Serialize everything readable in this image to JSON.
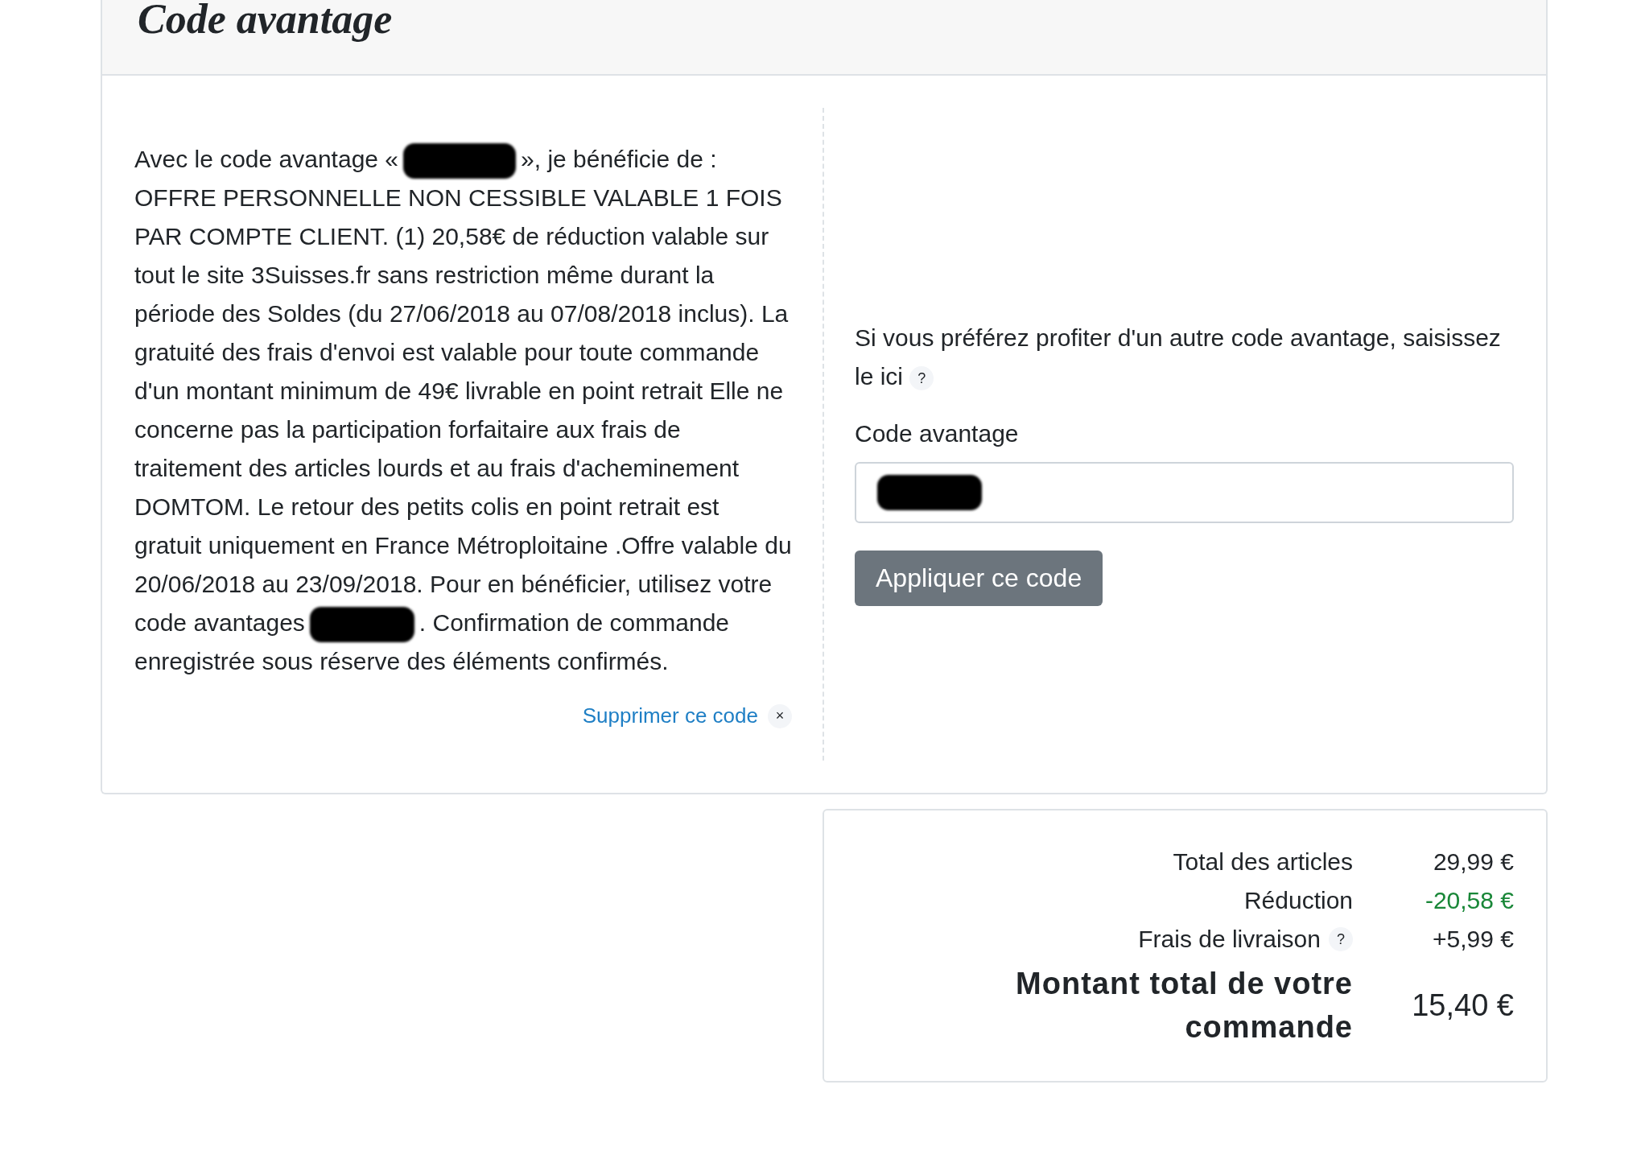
{
  "header": {
    "title": "Code avantage"
  },
  "applied_code": {
    "description_parts": [
      "Avec le code avantage «",
      "», je bénéficie de : OFFRE PERSONNELLE NON CESSIBLE VALABLE 1 FOIS PAR COMPTE CLIENT. (1) 20,58€ de réduction valable sur tout le site 3Suisses.fr sans restriction même durant la période des Soldes (du 27/06/2018 au 07/08/2018 inclus). La gratuité des frais d'envoi est valable pour toute commande d'un montant minimum de 49€ livrable en point retrait Elle ne concerne pas la participation forfaitaire aux frais de traitement des articles lourds et au frais d'acheminement DOMTOM. Le retour des petits colis en point retrait est gratuit uniquement en France Métroploitaine .Offre valable du 20/06/2018 au 23/09/2018. Pour en bénéficier, utilisez votre code avantages",
      ". Confirmation de commande enregistrée sous réserve des éléments confirmés."
    ],
    "remove_link": "Supprimer ce code",
    "remove_icon": "×"
  },
  "other_code": {
    "prompt": "Si vous préférez profiter d'un autre code avantage, saisissez le ici",
    "help": "?",
    "field_label": "Code avantage",
    "field_redacted": true,
    "button": "Appliquer ce code"
  },
  "summary": {
    "rows": [
      {
        "label": "Total des articles",
        "value": "29,99 €",
        "kind": "plain"
      },
      {
        "label": "Réduction",
        "value": "-20,58 €",
        "kind": "discount"
      },
      {
        "label": "Frais de livraison",
        "help": "?",
        "value": "+5,99 €",
        "kind": "plain"
      },
      {
        "label": "Montant total de votre commande",
        "value": "15,40 €",
        "kind": "total"
      }
    ]
  }
}
